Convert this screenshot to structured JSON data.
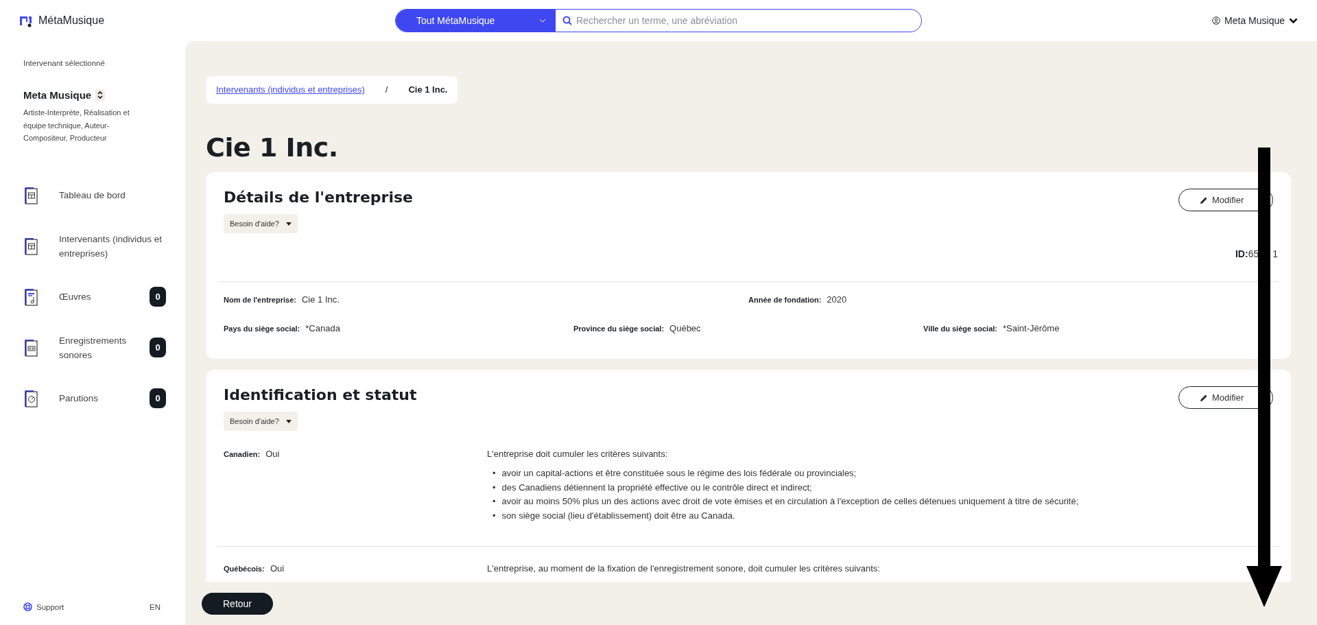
{
  "header": {
    "logo": "MétaMusique",
    "search": {
      "scope": "Tout MétaMusique",
      "placeholder": "Rechercher un terme, une abréviation"
    },
    "user": "Meta Musique"
  },
  "sidebar": {
    "caption": "Intervenant sélectionné",
    "selected_name": "Meta Musique",
    "roles": "Artiste-Interprète, Réalisation et équipe technique, Auteur-Compositeur, Producteur",
    "items": [
      {
        "kind": "dashboard",
        "label": "Tableau de bord"
      },
      {
        "kind": "dashboard",
        "label": "Intervenants (individus et entreprises)"
      },
      {
        "kind": "works",
        "label": "Œuvres",
        "count": "0"
      },
      {
        "kind": "recordings",
        "label": "Enregistrements sonores",
        "count": "0"
      },
      {
        "kind": "releases",
        "label": "Parutions",
        "count": "0"
      }
    ],
    "support": "Support",
    "language": "EN"
  },
  "breadcrumb": {
    "link": "Intervenants (individus et entreprises)",
    "separator": "/",
    "current": "Cie 1 Inc."
  },
  "page_title": "Cie 1 Inc.",
  "details": {
    "title": "Détails de l'entreprise",
    "help": "Besoin d'aide?",
    "edit": "Modifier",
    "id_label": "ID:",
    "id_parts": [
      "65",
      "1"
    ],
    "rows": [
      [
        {
          "label": "Nom de l'entreprise:",
          "value": "Cie 1 Inc."
        },
        {
          "label": "Année de fondation:",
          "value": "2020"
        }
      ],
      [
        {
          "label": "Pays du siège social:",
          "value": "*Canada"
        },
        {
          "label": "Province du siège social:",
          "value": "Québec"
        },
        {
          "label": "Ville du siège social:",
          "value": "*Saint-Jérôme"
        }
      ]
    ]
  },
  "status": {
    "title": "Identification et statut",
    "help": "Besoin d'aide?",
    "edit": "Modifier",
    "criteria": [
      {
        "label": "Canadien:",
        "value": "Oui",
        "intro": "L'entreprise doit cumuler les critères suivants:",
        "marker": "•",
        "bullets": [
          "avoir un capital-actions et être constituée sous le régime des lois fédérale ou provinciales;",
          "des Canadiens détiennent la propriété effective ou le contrôle direct et indirect;",
          "avoir au moins 50% plus un des actions avec droit de vote émises et en circulation à l'exception de celles détenues uniquement à titre de sécurité;",
          "son siège social (lieu d'établissement) doit être au Canada."
        ]
      },
      {
        "label": "Québécois:",
        "value": "Oui",
        "intro": "L'entreprise, au moment de la fixation de l'enregistrement sonore, doit cumuler les critères suivants:"
      }
    ]
  },
  "back_button": "Retour"
}
